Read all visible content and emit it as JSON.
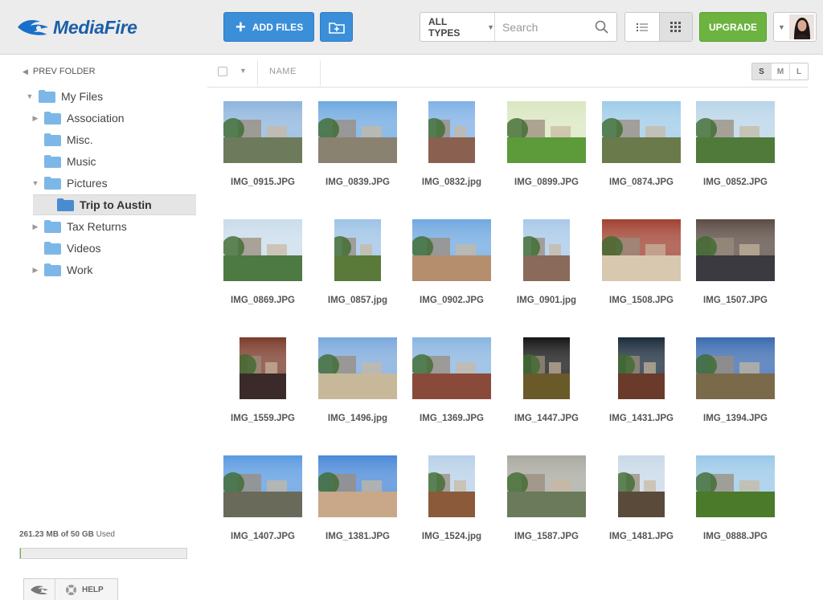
{
  "header": {
    "logo_text": "MediaFire",
    "add_files_label": "ADD FILES",
    "types_label": "ALL TYPES",
    "search_placeholder": "Search",
    "upgrade_label": "UPGRADE"
  },
  "sidebar": {
    "prev_folder_label": "PREV FOLDER",
    "tree": [
      {
        "label": "My Files",
        "depth": 0,
        "expanded": true,
        "has_children": true
      },
      {
        "label": "Association",
        "depth": 1,
        "expanded": false,
        "has_children": true
      },
      {
        "label": "Misc.",
        "depth": 1,
        "expanded": false,
        "has_children": false
      },
      {
        "label": "Music",
        "depth": 1,
        "expanded": false,
        "has_children": false
      },
      {
        "label": "Pictures",
        "depth": 1,
        "expanded": true,
        "has_children": true
      },
      {
        "label": "Trip to Austin",
        "depth": 2,
        "expanded": false,
        "has_children": false,
        "selected": true
      },
      {
        "label": "Tax Returns",
        "depth": 1,
        "expanded": false,
        "has_children": true
      },
      {
        "label": "Videos",
        "depth": 1,
        "expanded": false,
        "has_children": false
      },
      {
        "label": "Work",
        "depth": 1,
        "expanded": false,
        "has_children": true
      }
    ],
    "storage_used": "261.23 MB of 50 GB",
    "storage_suffix": "Used",
    "storage_fraction": 0.005,
    "help_label": "HELP"
  },
  "content": {
    "name_header": "NAME",
    "size_options": [
      "S",
      "M",
      "L"
    ],
    "active_size": "S",
    "files": [
      {
        "name": "IMG_0915.JPG",
        "orient": "landscape",
        "sky": "#8db4dc",
        "ground": "#6e7a5c"
      },
      {
        "name": "IMG_0839.JPG",
        "orient": "landscape",
        "sky": "#6ea8e0",
        "ground": "#8a8270"
      },
      {
        "name": "IMG_0832.jpg",
        "orient": "portrait",
        "sky": "#7fb0e6",
        "ground": "#8a6050"
      },
      {
        "name": "IMG_0899.JPG",
        "orient": "landscape",
        "sky": "#d9e6c0",
        "ground": "#5c9a3a"
      },
      {
        "name": "IMG_0874.JPG",
        "orient": "landscape",
        "sky": "#9ecbe8",
        "ground": "#6a7a4a"
      },
      {
        "name": "IMG_0852.JPG",
        "orient": "landscape",
        "sky": "#b8d4e8",
        "ground": "#4f7a3a"
      },
      {
        "name": "IMG_0869.JPG",
        "orient": "landscape",
        "sky": "#c9dcea",
        "ground": "#4d7a42"
      },
      {
        "name": "IMG_0857.jpg",
        "orient": "portrait",
        "sky": "#9dc3e6",
        "ground": "#5a7a3a"
      },
      {
        "name": "IMG_0902.JPG",
        "orient": "landscape",
        "sky": "#6fa8e0",
        "ground": "#b58e6e"
      },
      {
        "name": "IMG_0901.jpg",
        "orient": "portrait",
        "sky": "#a8c8e8",
        "ground": "#8a6a5a"
      },
      {
        "name": "IMG_1508.JPG",
        "orient": "landscape",
        "sky": "#a04030",
        "ground": "#d8c8b0"
      },
      {
        "name": "IMG_1507.JPG",
        "orient": "landscape",
        "sky": "#5a4a42",
        "ground": "#3a3a40"
      },
      {
        "name": "IMG_1559.JPG",
        "orient": "portrait",
        "sky": "#7a3a2a",
        "ground": "#3a2a2a"
      },
      {
        "name": "IMG_1496.jpg",
        "orient": "landscape",
        "sky": "#7aa8dc",
        "ground": "#c8b89a"
      },
      {
        "name": "IMG_1369.JPG",
        "orient": "landscape",
        "sky": "#88b4e0",
        "ground": "#8a4a3a"
      },
      {
        "name": "IMG_1447.JPG",
        "orient": "portrait",
        "sky": "#141414",
        "ground": "#6a5a2a"
      },
      {
        "name": "IMG_1431.JPG",
        "orient": "portrait",
        "sky": "#1a2a3a",
        "ground": "#6a3a2a"
      },
      {
        "name": "IMG_1394.JPG",
        "orient": "landscape",
        "sky": "#3a6ab0",
        "ground": "#7a6a4a"
      },
      {
        "name": "IMG_1407.JPG",
        "orient": "landscape",
        "sky": "#5a9ae0",
        "ground": "#6a6a5a"
      },
      {
        "name": "IMG_1381.JPG",
        "orient": "landscape",
        "sky": "#4a88d8",
        "ground": "#c8a888"
      },
      {
        "name": "IMG_1524.jpg",
        "orient": "portrait",
        "sky": "#b8d0e8",
        "ground": "#8a5a3a"
      },
      {
        "name": "IMG_1587.JPG",
        "orient": "landscape",
        "sky": "#a8a8a0",
        "ground": "#6a7a5a"
      },
      {
        "name": "IMG_1481.JPG",
        "orient": "portrait",
        "sky": "#c8d8e8",
        "ground": "#5a4a3a"
      },
      {
        "name": "IMG_0888.JPG",
        "orient": "landscape",
        "sky": "#9ac8e8",
        "ground": "#4a7a2a"
      }
    ]
  },
  "colors": {
    "accent_blue": "#3b8fd9",
    "upgrade_green": "#6cb33f",
    "folder_blue": "#7db7e8",
    "selected_folder": "#4a8cd0"
  }
}
